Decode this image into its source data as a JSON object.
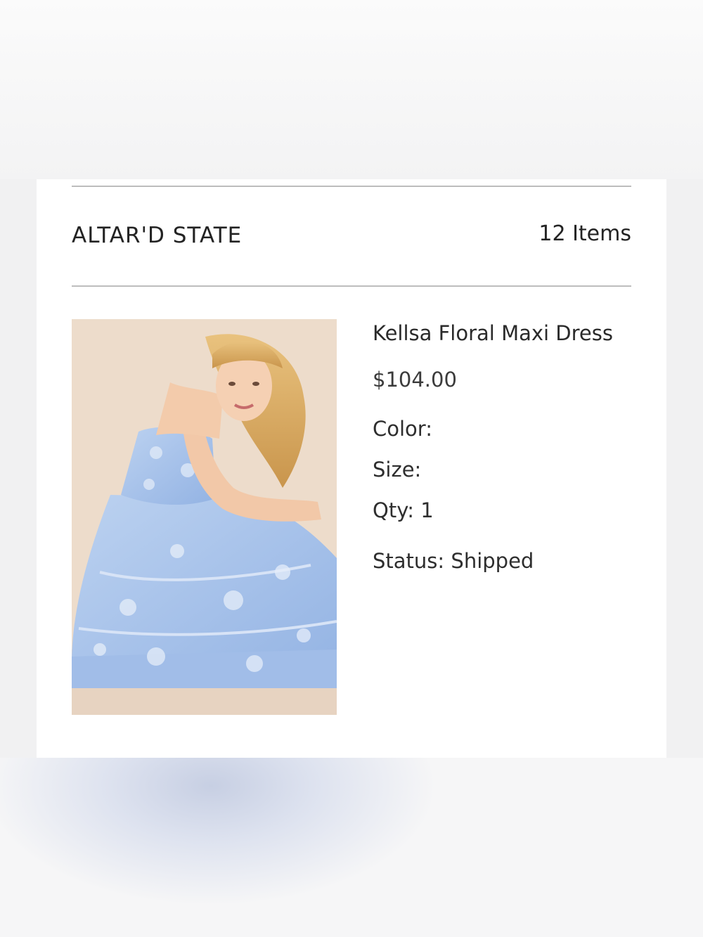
{
  "order_group": {
    "brand": "ALTAR'D STATE",
    "item_count": "12 Items"
  },
  "item": {
    "name": "Kellsa Floral Maxi Dress",
    "price": "$104.00",
    "color_label": "Color:",
    "color_value": "",
    "size_label": "Size:",
    "size_value": "",
    "qty_label": "Qty:",
    "qty_value": "1",
    "status_label": "Status:",
    "status_value": "Shipped",
    "image_icon": "product-photo-dress"
  },
  "colors": {
    "card_background": "#ffffff",
    "divider": "#bdbdbd",
    "text": "#232323",
    "dress_blue": "#a9c4ea"
  }
}
